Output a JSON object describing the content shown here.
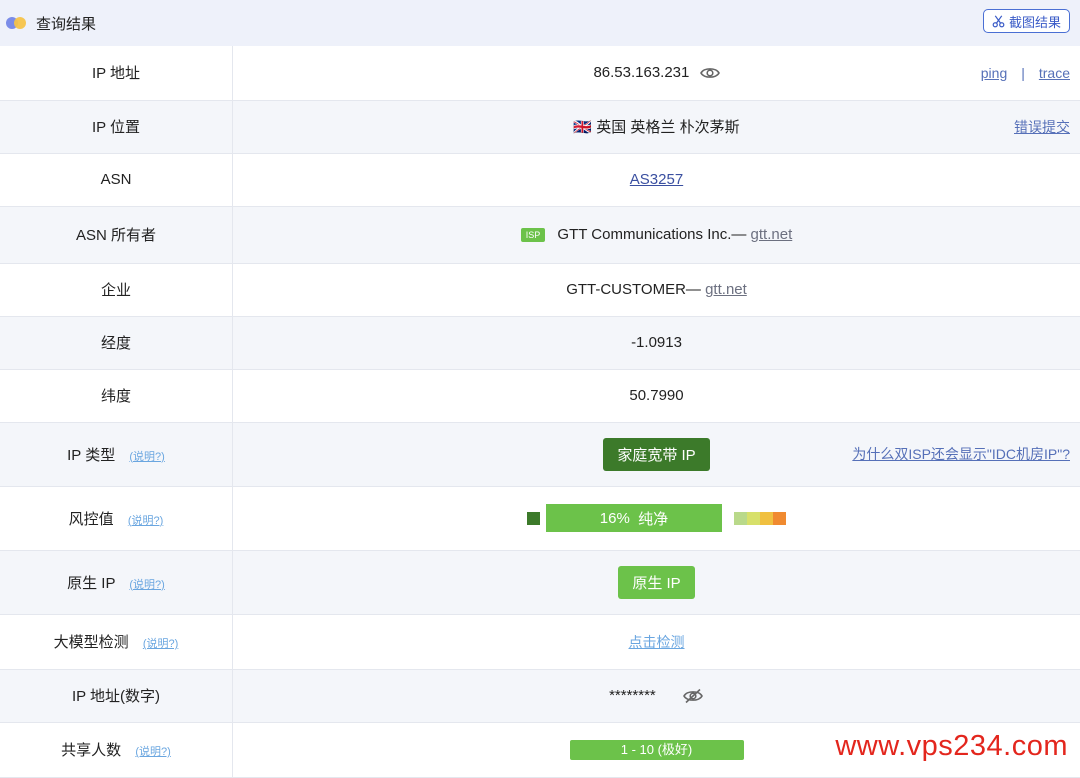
{
  "header": {
    "title": "查询结果",
    "screenshot_button": "截图结果"
  },
  "rows": {
    "ip": {
      "label": "IP 地址",
      "value": "86.53.163.231",
      "ping": "ping",
      "separator": "|",
      "trace": "trace"
    },
    "location": {
      "label": "IP 位置",
      "flag": "🇬🇧",
      "value": "英国 英格兰 朴次茅斯",
      "action": "错误提交"
    },
    "asn": {
      "label": "ASN",
      "value": "AS3257"
    },
    "asn_owner": {
      "label": "ASN 所有者",
      "badge": "ISP",
      "value": "GTT Communications Inc.—",
      "domain": "gtt.net"
    },
    "company": {
      "label": "企业",
      "value": "GTT-CUSTOMER—",
      "domain": "gtt.net"
    },
    "longitude": {
      "label": "经度",
      "value": "-1.0913"
    },
    "latitude": {
      "label": "纬度",
      "value": "50.7990"
    },
    "ip_type": {
      "label": "IP 类型",
      "help": "(说明?)",
      "value": "家庭宽带 IP",
      "question": "为什么双ISP还会显示\"IDC机房IP\"?"
    },
    "risk": {
      "label": "风控值",
      "help": "(说明?)",
      "percent": "16%",
      "level": "纯净",
      "fraction": 0.16
    },
    "native_ip": {
      "label": "原生 IP",
      "help": "(说明?)",
      "value": "原生 IP"
    },
    "llm_detect": {
      "label": "大模型检测",
      "help": "(说明?)",
      "value": "点击检测"
    },
    "ip_numeric": {
      "label": "IP 地址(数字)",
      "value": "********"
    },
    "shared_users": {
      "label": "共享人数",
      "help": "(说明?)",
      "value": "1 - 10 (极好)"
    }
  },
  "colors": {
    "green": "#6cc24a",
    "dark_green": "#3c7a2a",
    "link": "#3a4fa0",
    "watermark": "#e3261d",
    "risk_scale": [
      "#b9d98a",
      "#d7e06a",
      "#f0c040",
      "#f08a30",
      "#e0382a"
    ]
  },
  "watermark": "www.vps234.com"
}
